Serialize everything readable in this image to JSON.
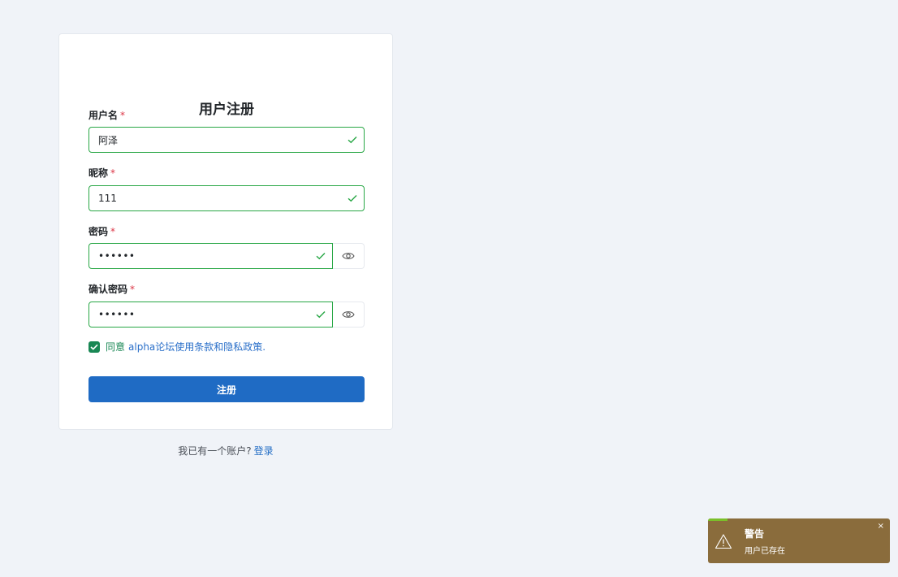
{
  "form": {
    "title": "用户注册",
    "required_mark": "*",
    "username": {
      "label": "用户名",
      "value": "阿泽"
    },
    "nickname": {
      "label": "昵称",
      "value": "111"
    },
    "password": {
      "label": "密码",
      "value": "••••••"
    },
    "confirm_password": {
      "label": "确认密码",
      "value": "••••••"
    },
    "agree": {
      "checked": true,
      "label": "同意",
      "link": "alpha论坛使用条款和隐私政策."
    },
    "submit_label": "注册"
  },
  "footer": {
    "text": "我已有一个账户?",
    "login_link": "登录"
  },
  "toast": {
    "title": "警告",
    "message": "用户已存在",
    "close": "×"
  },
  "colors": {
    "page_bg": "#f0f3f8",
    "valid_green": "#28a745",
    "primary": "#1f6bc4",
    "toast_bg": "#8a6c3c",
    "required": "#dc3545"
  }
}
